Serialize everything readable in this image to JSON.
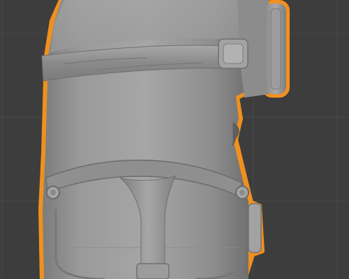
{
  "app": {
    "name": "",
    "view": "3d-viewport"
  },
  "viewport": {
    "background_color": "#3d3d3d",
    "grid_color": "#484848",
    "grid_visible": true,
    "selection_outline_color": "#f0901e",
    "mesh_base_color": "#9a9a9a",
    "object": {
      "kind": "sculpted-mesh",
      "description_icon": "minion-like-body-with-goggle-and-overalls",
      "selected": true
    }
  }
}
